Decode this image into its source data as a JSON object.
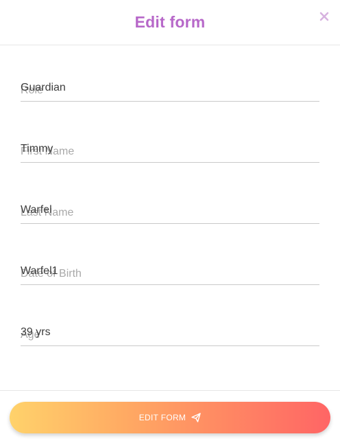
{
  "modal": {
    "title": "Edit form",
    "close_icon": "close-icon"
  },
  "fields": {
    "role": {
      "label": "Role",
      "value": "Guardian"
    },
    "first_name": {
      "label": "First Name",
      "value": "Timmy"
    },
    "last_name": {
      "label": "Last Name",
      "value": "Warfel"
    },
    "date_of_birth": {
      "label": "Date of Birth",
      "value": "Warfel1"
    },
    "age": {
      "label": "Age",
      "value": "39 yrs"
    }
  },
  "footer": {
    "submit_label": "EDIT FORM",
    "submit_icon": "paper-plane-icon"
  },
  "colors": {
    "title": "#b768c9",
    "close": "#d7b3e0",
    "gradient_start": "#ffd26b",
    "gradient_end": "#ff6565"
  }
}
